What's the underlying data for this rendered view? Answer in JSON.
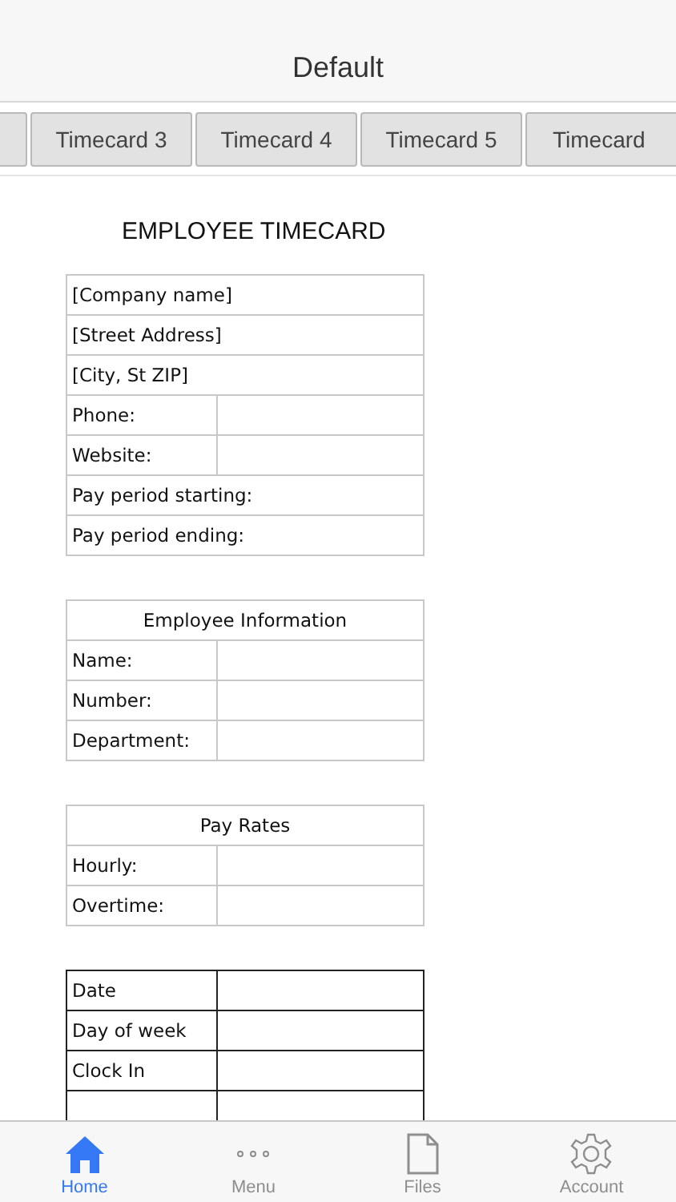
{
  "header": {
    "title": "Default"
  },
  "tabs": [
    {
      "label": "Timecard 3"
    },
    {
      "label": "Timecard 4"
    },
    {
      "label": "Timecard 5"
    },
    {
      "label": "Timecard"
    }
  ],
  "document": {
    "title": "EMPLOYEE TIMECARD",
    "tables": [
      {
        "kind": "light",
        "rows": [
          {
            "kind": "full",
            "label": "[Company name]"
          },
          {
            "kind": "full",
            "label": "[Street Address]"
          },
          {
            "kind": "full",
            "label": "[City, St ZIP]"
          },
          {
            "kind": "pair",
            "label": "Phone:"
          },
          {
            "kind": "pair",
            "label": "Website:"
          },
          {
            "kind": "full",
            "label": "Pay period starting:"
          },
          {
            "kind": "full",
            "label": "Pay period ending:"
          }
        ]
      },
      {
        "kind": "light",
        "rows": [
          {
            "kind": "heading",
            "label": "Employee Information"
          },
          {
            "kind": "pair",
            "label": "Name:"
          },
          {
            "kind": "pair",
            "label": "Number:"
          },
          {
            "kind": "pair",
            "label": "Department:"
          }
        ]
      },
      {
        "kind": "light",
        "rows": [
          {
            "kind": "heading",
            "label": "Pay Rates"
          },
          {
            "kind": "pair",
            "label": "Hourly:"
          },
          {
            "kind": "pair",
            "label": "Overtime:"
          }
        ]
      },
      {
        "kind": "dark",
        "rows": [
          {
            "kind": "pair",
            "label": "Date"
          },
          {
            "kind": "pair",
            "label": "Day of week"
          },
          {
            "kind": "pair",
            "label": "Clock In"
          }
        ]
      }
    ]
  },
  "tab_bar": [
    {
      "kind": "home",
      "label": "Home",
      "selected": true
    },
    {
      "kind": "menu",
      "label": "Menu",
      "selected": false
    },
    {
      "kind": "file",
      "label": "Files",
      "selected": false
    },
    {
      "kind": "gear",
      "label": "Account",
      "selected": false
    }
  ]
}
